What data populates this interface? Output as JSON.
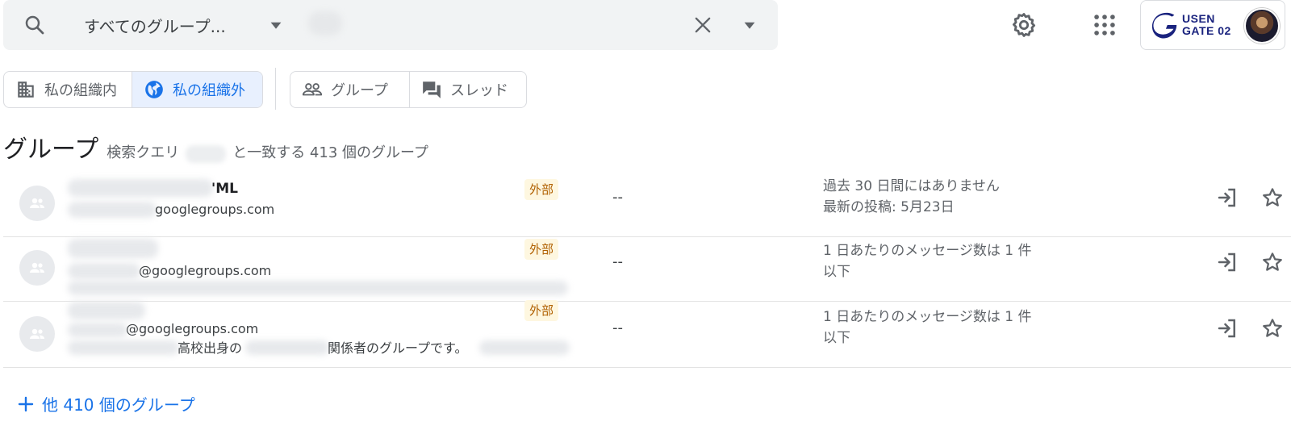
{
  "search": {
    "scope": "すべてのグループ...",
    "icon": "search-icon"
  },
  "filters": {
    "org_internal": "私の組織内",
    "org_external": "私の組織外",
    "groups": "グループ",
    "threads": "スレッド"
  },
  "heading": {
    "title": "グループ",
    "prefix": "検索クエリ",
    "suffix": "と一致する 413 個のグループ"
  },
  "account": {
    "logo_line1": "USEN",
    "logo_line2": "GATE 02"
  },
  "rows": [
    {
      "name_suffix": "'ML",
      "email_suffix": "googlegroups.com",
      "badge": "外部",
      "posts": "--",
      "activity_line1": "過去 30 日間にはありません",
      "activity_line2": "最新の投稿: 5月23日"
    },
    {
      "email_suffix": "@googlegroups.com",
      "badge": "外部",
      "posts": "--",
      "activity_line1": "1 日あたりのメッセージ数は 1 件",
      "activity_line2": "以下"
    },
    {
      "email_suffix": "@googlegroups.com",
      "desc_part1": "高校出身の",
      "desc_part2": "関係者のグループです。",
      "badge": "外部",
      "posts": "--",
      "activity_line1": "1 日あたりのメッセージ数は 1 件",
      "activity_line2": "以下"
    }
  ],
  "more_groups": "他 410 個のグループ",
  "colors": {
    "accent": "#1a73e8",
    "badge_bg": "#fef7e0",
    "badge_text": "#b06000",
    "search_bg": "#f1f3f4"
  }
}
